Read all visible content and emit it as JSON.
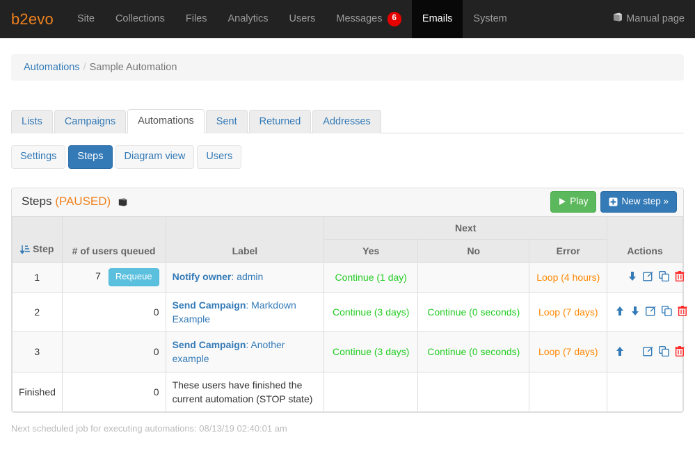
{
  "topnav": {
    "brand": "b2evo",
    "items": [
      {
        "label": "Site",
        "active": false
      },
      {
        "label": "Collections",
        "active": false
      },
      {
        "label": "Files",
        "active": false
      },
      {
        "label": "Analytics",
        "active": false
      },
      {
        "label": "Users",
        "active": false
      },
      {
        "label": "Messages",
        "active": false,
        "badge": "6"
      },
      {
        "label": "Emails",
        "active": true
      },
      {
        "label": "System",
        "active": false
      }
    ],
    "manual": {
      "label": "Manual page",
      "icon": "book-icon"
    }
  },
  "breadcrumb": {
    "root": "Automations",
    "separator": "/",
    "current": "Sample Automation"
  },
  "tabs": [
    {
      "label": "Lists",
      "active": false
    },
    {
      "label": "Campaigns",
      "active": false
    },
    {
      "label": "Automations",
      "active": true
    },
    {
      "label": "Sent",
      "active": false
    },
    {
      "label": "Returned",
      "active": false
    },
    {
      "label": "Addresses",
      "active": false
    }
  ],
  "subtabs": [
    {
      "label": "Settings",
      "active": false
    },
    {
      "label": "Steps",
      "active": true
    },
    {
      "label": "Diagram view",
      "active": false
    },
    {
      "label": "Users",
      "active": false
    }
  ],
  "panel": {
    "title": "Steps",
    "status": "(PAUSED)",
    "help_icon": "book-icon",
    "play_button": "Play",
    "new_step_button": "New step »"
  },
  "table": {
    "group_header": "Next",
    "headers": {
      "step": "Step",
      "queued": "# of users queued",
      "label": "Label",
      "yes": "Yes",
      "no": "No",
      "error": "Error",
      "actions": "Actions"
    },
    "sort_icon": "sort-amount-asc-icon",
    "rows": [
      {
        "step": "1",
        "queued": "7",
        "requeue": "Requeue",
        "label_bold": "Notify owner",
        "label_sep": ": ",
        "label_rest": "admin",
        "yes": "Continue (1 day)",
        "no": "",
        "error": "Loop (4 hours)",
        "actions": [
          "move-down-icon",
          "edit-icon",
          "duplicate-icon",
          "delete-icon"
        ]
      },
      {
        "step": "2",
        "queued": "0",
        "requeue": "",
        "label_bold": "Send Campaign",
        "label_sep": ": ",
        "label_rest": "Markdown Example",
        "yes": "Continue (3 days)",
        "no": "Continue (0 seconds)",
        "error": "Loop (7 days)",
        "actions": [
          "move-up-icon",
          "move-down-icon",
          "edit-icon",
          "duplicate-icon",
          "delete-icon"
        ]
      },
      {
        "step": "3",
        "queued": "0",
        "requeue": "",
        "label_bold": "Send Campaign",
        "label_sep": ": ",
        "label_rest": "Another example",
        "yes": "Continue (3 days)",
        "no": "Continue (0 seconds)",
        "error": "Loop (7 days)",
        "actions": [
          "move-up-icon",
          "edit-icon",
          "duplicate-icon",
          "delete-icon"
        ]
      },
      {
        "step": "Finished",
        "queued": "0",
        "requeue": "",
        "label_plain": "These users have finished the current automation (STOP state)",
        "yes": "",
        "no": "",
        "error": "",
        "actions": []
      }
    ]
  },
  "footnote": "Next scheduled job for executing automations: 08/13/19 02:40:01 am",
  "colors": {
    "brand_orange": "#f0821e",
    "nav_bg": "#222222",
    "link_blue": "#337ab7",
    "green": "#22cc22",
    "orange": "#ff8800",
    "danger_red": "#e60000",
    "info_cyan": "#5bc0de"
  }
}
